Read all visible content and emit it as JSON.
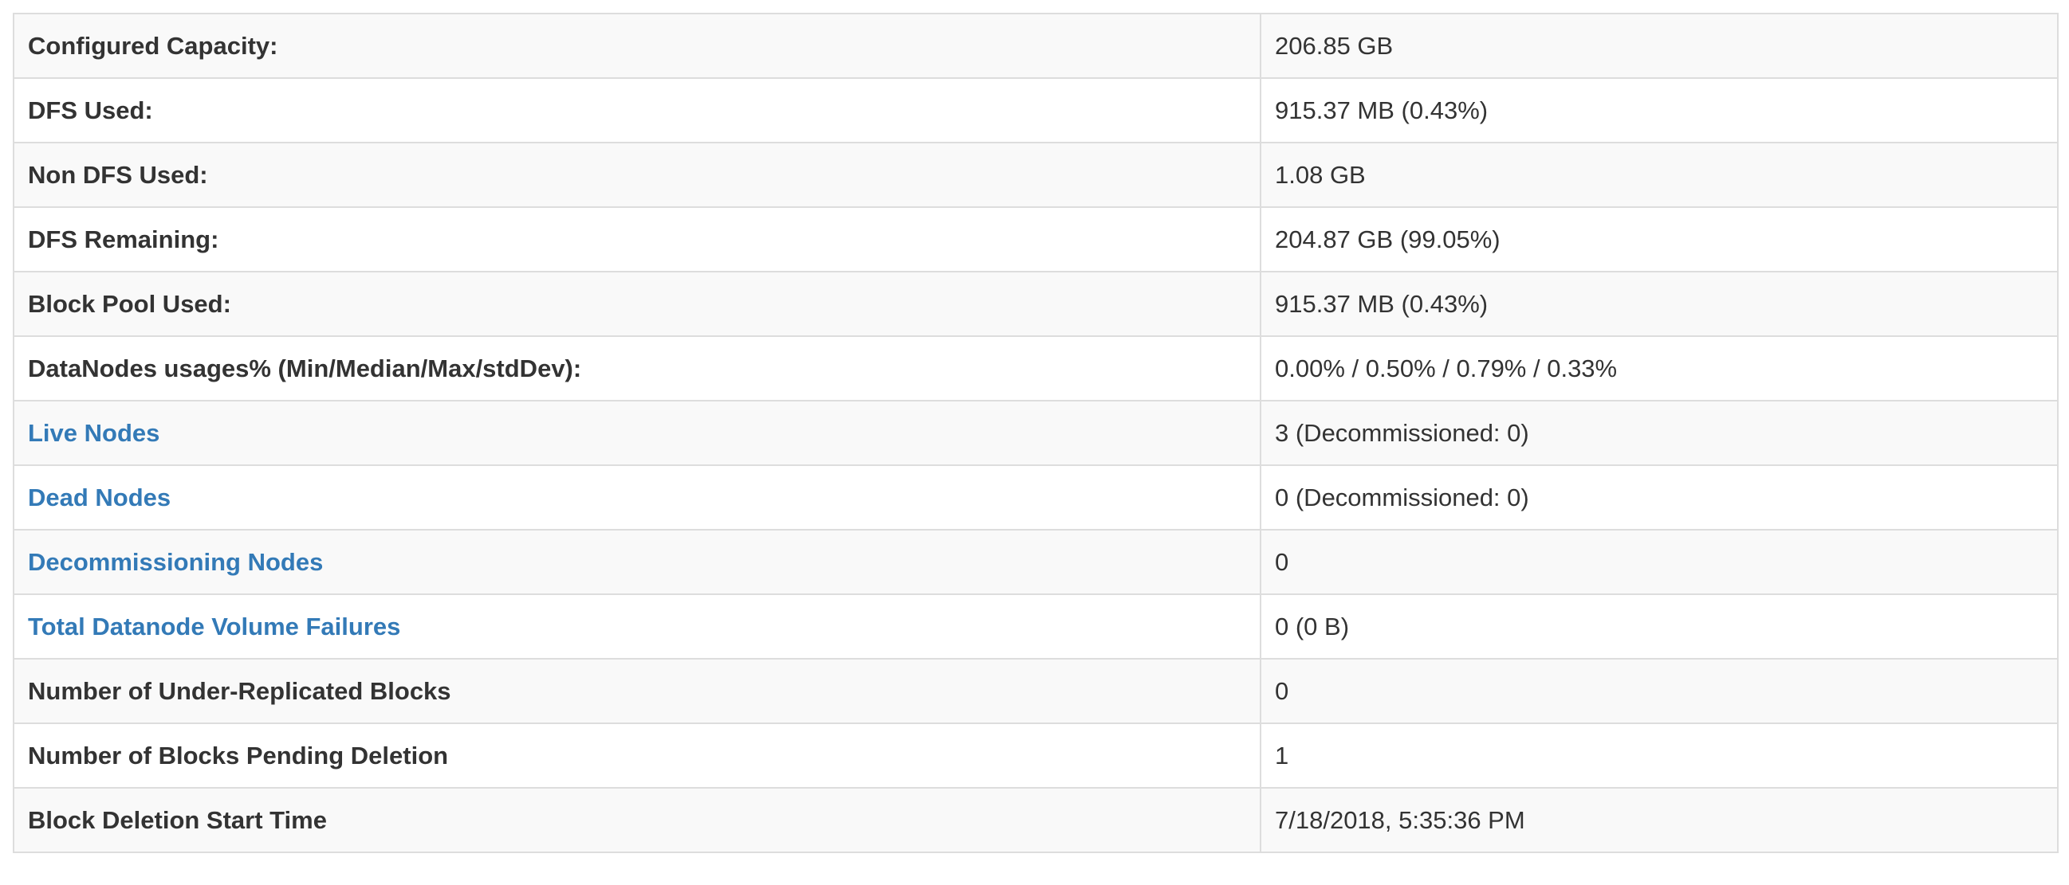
{
  "summary": {
    "rows": [
      {
        "label": "Configured Capacity:",
        "value": "206.85 GB",
        "link": false
      },
      {
        "label": "DFS Used:",
        "value": "915.37 MB (0.43%)",
        "link": false
      },
      {
        "label": "Non DFS Used:",
        "value": "1.08 GB",
        "link": false
      },
      {
        "label": "DFS Remaining:",
        "value": "204.87 GB (99.05%)",
        "link": false
      },
      {
        "label": "Block Pool Used:",
        "value": "915.37 MB (0.43%)",
        "link": false
      },
      {
        "label": "DataNodes usages% (Min/Median/Max/stdDev):",
        "value": "0.00% / 0.50% / 0.79% / 0.33%",
        "link": false
      },
      {
        "label": "Live Nodes",
        "value": "3 (Decommissioned: 0)",
        "link": true
      },
      {
        "label": "Dead Nodes",
        "value": "0 (Decommissioned: 0)",
        "link": true
      },
      {
        "label": "Decommissioning Nodes",
        "value": "0",
        "link": true
      },
      {
        "label": "Total Datanode Volume Failures",
        "value": "0 (0 B)",
        "link": true
      },
      {
        "label": "Number of Under-Replicated Blocks",
        "value": "0",
        "link": false
      },
      {
        "label": "Number of Blocks Pending Deletion",
        "value": "1",
        "link": false
      },
      {
        "label": "Block Deletion Start Time",
        "value": "7/18/2018, 5:35:36 PM",
        "link": false
      }
    ]
  },
  "colors": {
    "link": "#337ab7",
    "text": "#333333",
    "stripe": "#f9f9f9",
    "border": "#dddddd"
  }
}
